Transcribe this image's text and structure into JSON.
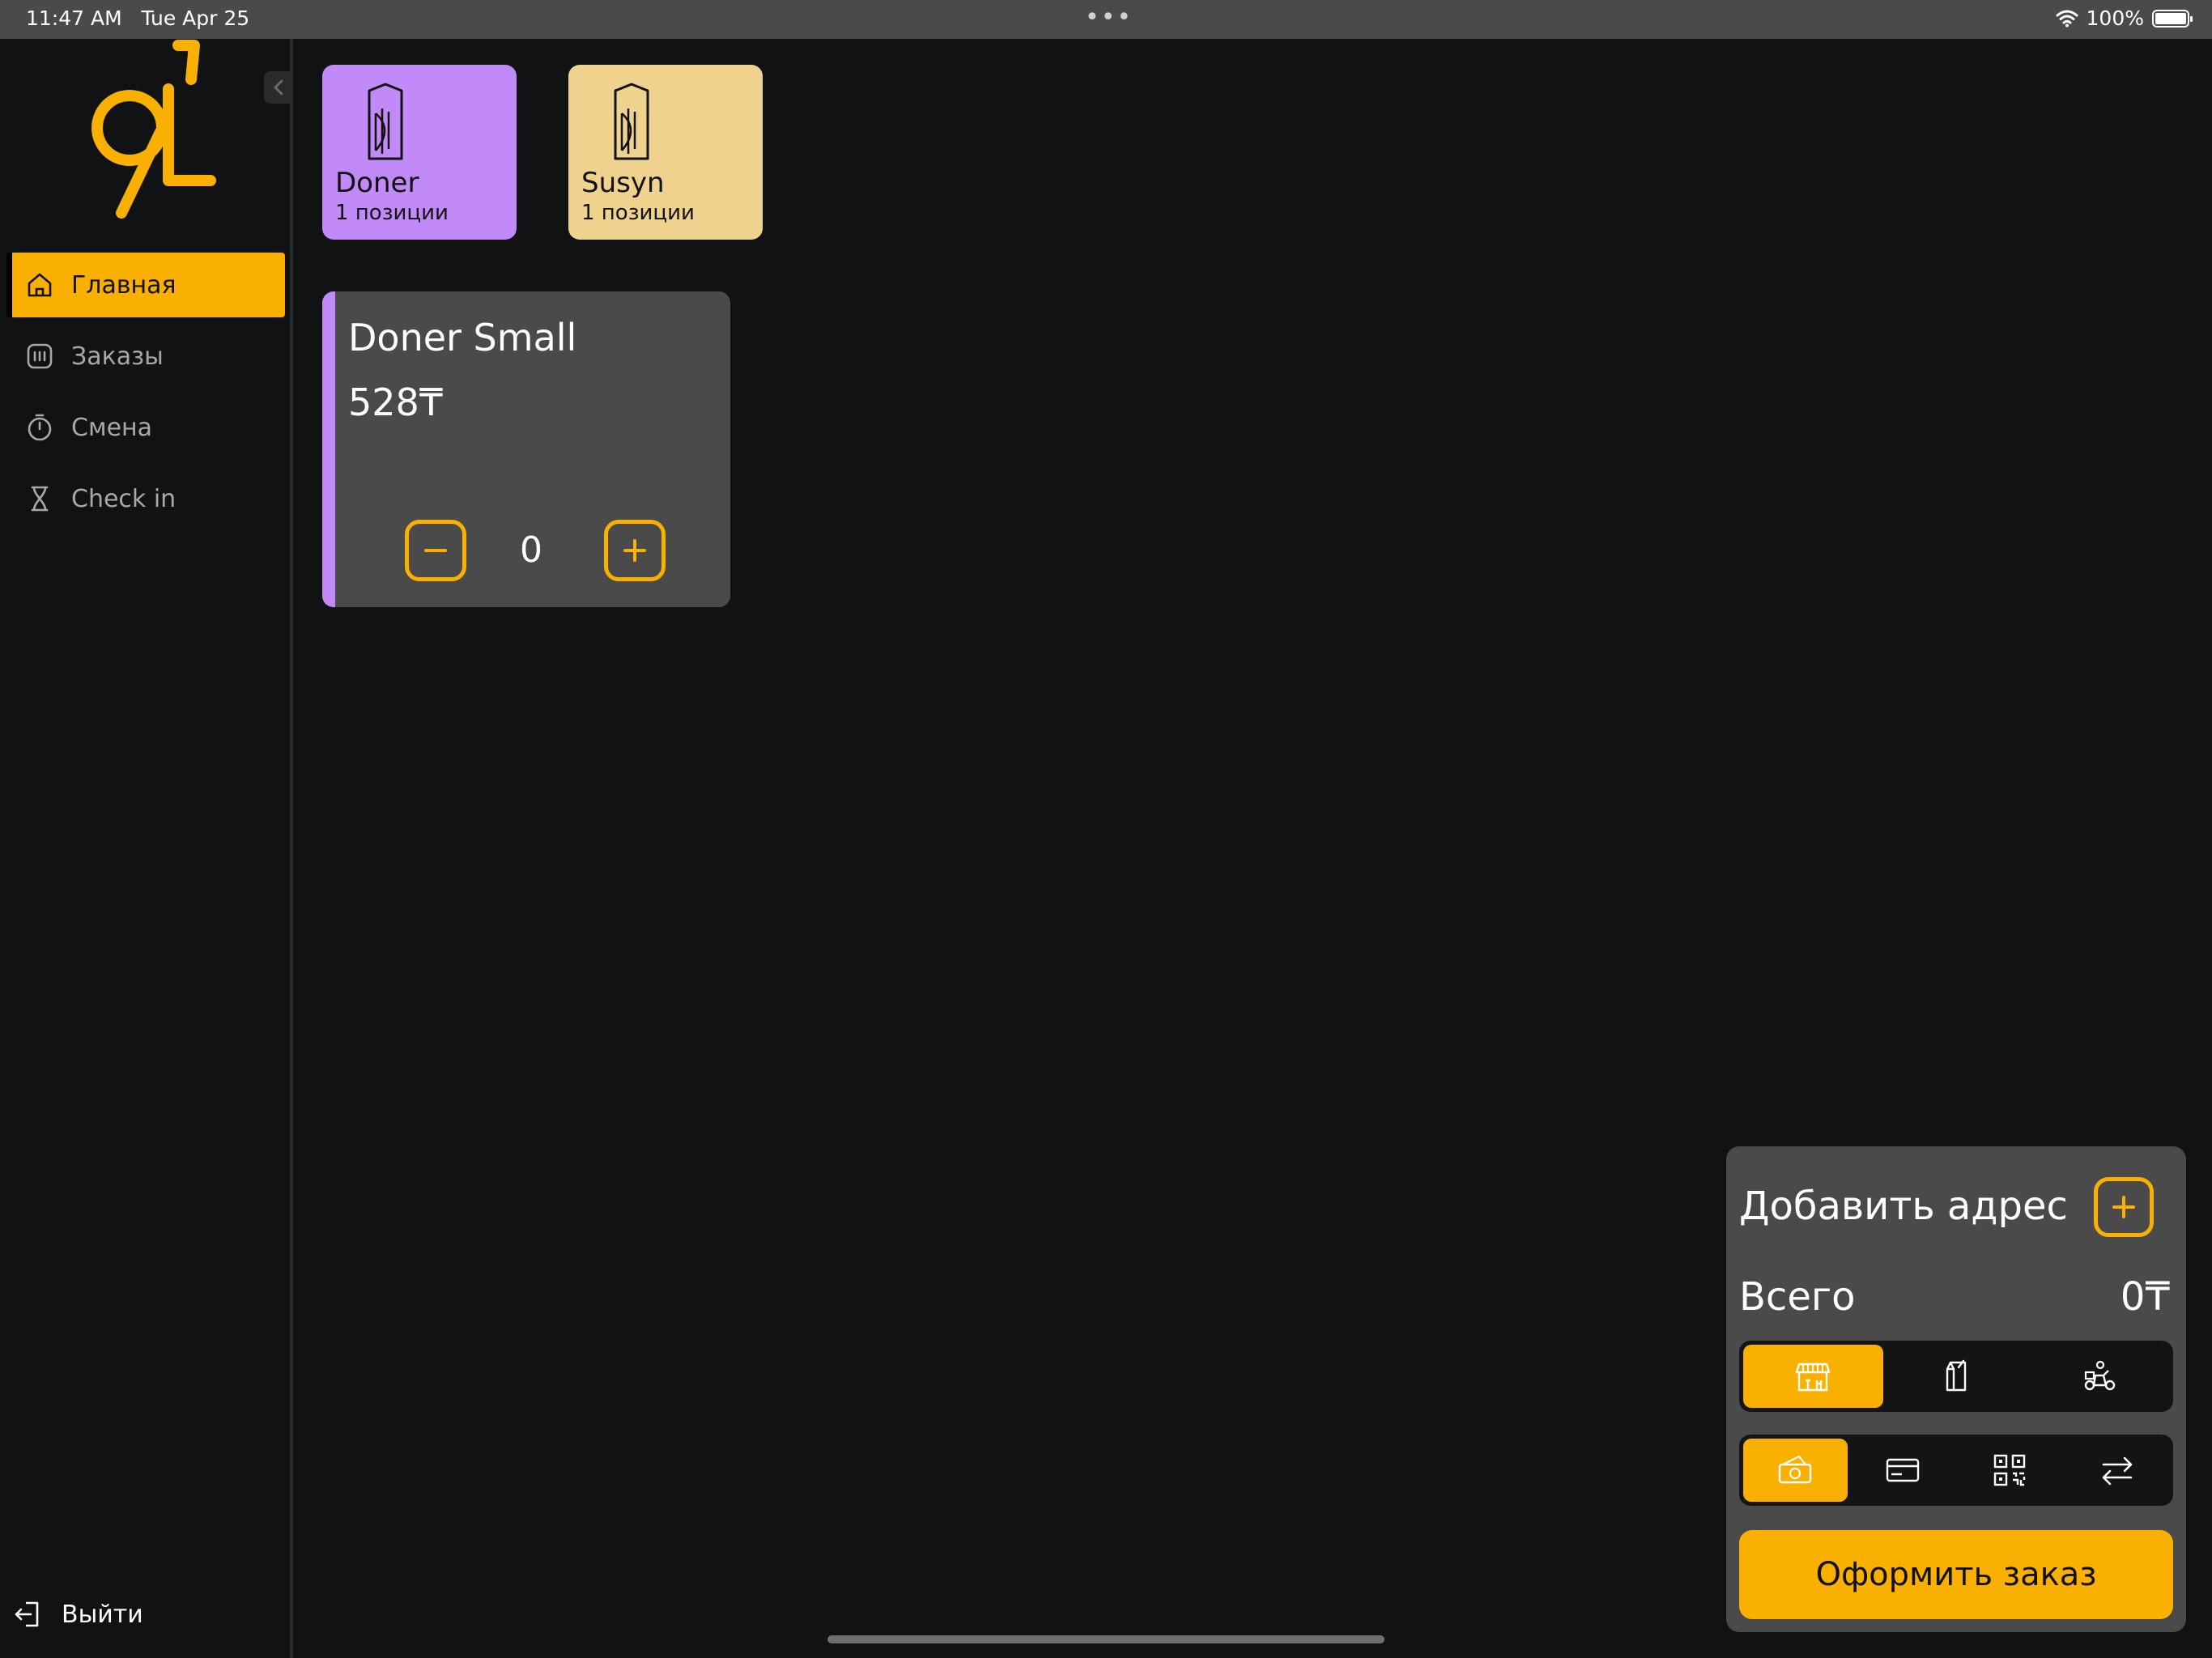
{
  "status_bar": {
    "time": "11:47 AM",
    "date": "Tue Apr 25",
    "dots": "•••",
    "battery": "100%"
  },
  "colors": {
    "accent": "#f9b000",
    "doner_category": "#c289f8",
    "susyn_category": "#efd28d",
    "background": "#111214",
    "panel": "#4a4a4a"
  },
  "sidebar": {
    "logo_icon": "brand-91-logo-icon",
    "items": [
      {
        "label": "Главная",
        "icon": "home-icon",
        "active": true
      },
      {
        "label": "Заказы",
        "icon": "orders-icon",
        "active": false
      },
      {
        "label": "Смена",
        "icon": "timer-icon",
        "active": false
      },
      {
        "label": "Check in",
        "icon": "hourglass-icon",
        "active": false
      }
    ],
    "logout_label": "Выйти"
  },
  "categories": [
    {
      "name": "Doner",
      "count": "1 позиции",
      "icon": "wrap-icon"
    },
    {
      "name": "Susyn",
      "count": "1 позиции",
      "icon": "wrap-icon"
    }
  ],
  "products": [
    {
      "name": "Doner Small",
      "price": "528₸",
      "quantity": "0"
    }
  ],
  "order_panel": {
    "address_label": "Добавить адрес",
    "total_label": "Всего",
    "total_value": "0₸",
    "order_types": [
      {
        "icon": "store-icon",
        "active": true
      },
      {
        "icon": "takeaway-bag-icon",
        "active": false
      },
      {
        "icon": "delivery-scooter-icon",
        "active": false
      }
    ],
    "payment_methods": [
      {
        "icon": "cash-icon",
        "active": true
      },
      {
        "icon": "card-icon",
        "active": false
      },
      {
        "icon": "qr-code-icon",
        "active": false
      },
      {
        "icon": "transfer-icon",
        "active": false
      }
    ],
    "submit_label": "Оформить заказ"
  }
}
